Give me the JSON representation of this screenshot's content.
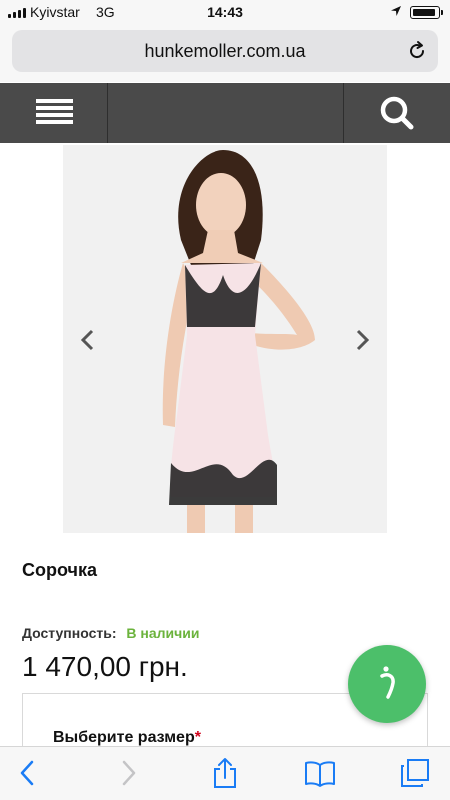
{
  "status_bar": {
    "carrier": "Kyivstar",
    "network": "3G",
    "time": "14:43"
  },
  "browser": {
    "url": "hunkemoller.com.ua"
  },
  "product": {
    "title": "Сорочка",
    "availability_label": "Доступность:",
    "availability_value": "В наличии",
    "price": "1 470,00 грн.",
    "size_label": "Выберите размер",
    "size_required_mark": "*"
  },
  "colors": {
    "header_bg": "#4a4a4a",
    "in_stock": "#6bb33c",
    "required": "#d0021b",
    "chat_button": "#4cbf6a",
    "ios_blue": "#1a7cf5"
  },
  "icons": {
    "menu": "hamburger-icon",
    "search": "search-icon",
    "prev": "chevron-left-icon",
    "next": "chevron-right-icon",
    "chat": "chat-icon",
    "reload": "reload-icon",
    "back": "back-icon",
    "forward": "forward-icon",
    "share": "share-icon",
    "bookmarks": "bookmarks-icon",
    "tabs": "tabs-icon"
  }
}
